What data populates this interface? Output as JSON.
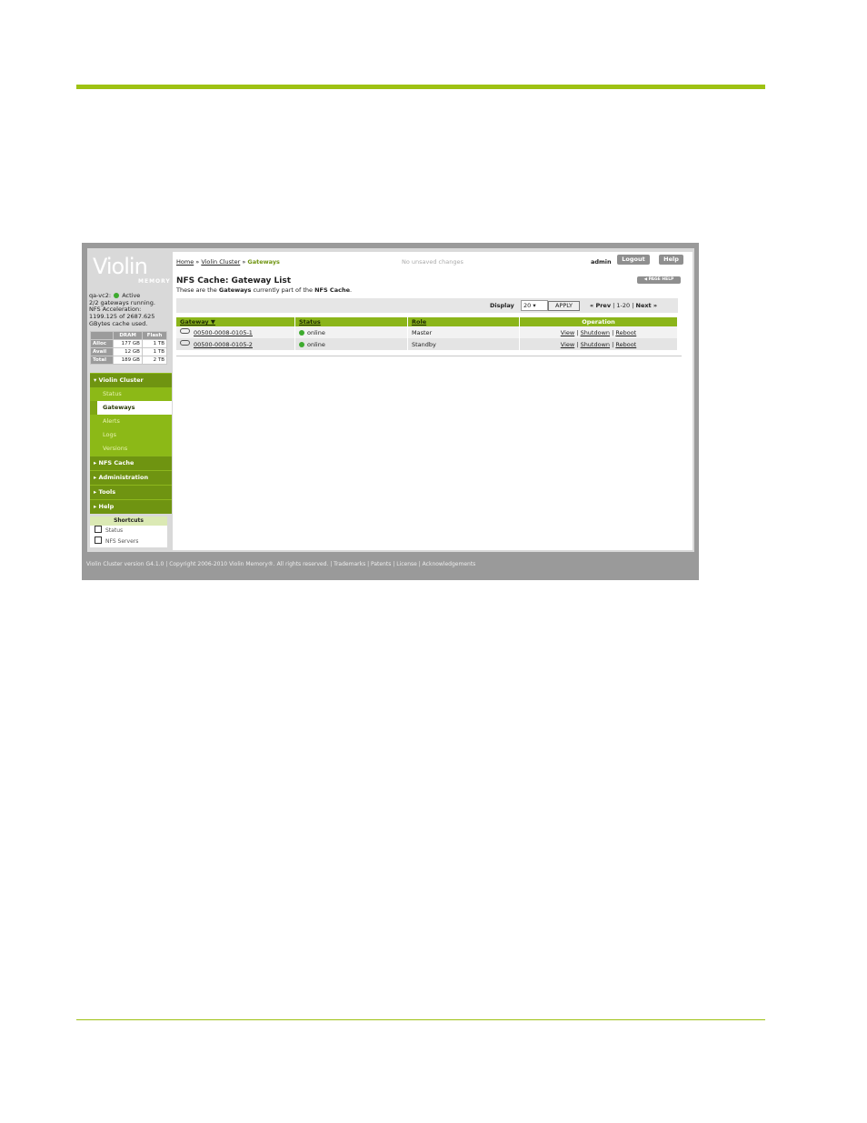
{
  "brand": {
    "logo_text": "Violin",
    "logo_sub": "MEMORY"
  },
  "system": {
    "name": "qa-vc2:",
    "state": "Active",
    "line1": "2/2 gateways running.",
    "line2": "NFS Acceleration:",
    "line3": "1199.125 of 2687.625",
    "line4": "GBytes cache used."
  },
  "stats": {
    "headers": [
      "DRAM",
      "Flash"
    ],
    "rows": [
      {
        "label": "Alloc",
        "dram": "177 GB",
        "flash": "1 TB"
      },
      {
        "label": "Avail",
        "dram": "12 GB",
        "flash": "1 TB"
      },
      {
        "label": "Total",
        "dram": "189 GB",
        "flash": "2 TB"
      }
    ]
  },
  "nav": {
    "violin_cluster": "Violin Cluster",
    "sub": [
      "Status",
      "Gateways",
      "Alerts",
      "Logs",
      "Versions"
    ],
    "nfs_cache": "NFS Cache",
    "administration": "Administration",
    "tools": "Tools",
    "help": "Help"
  },
  "shortcuts": {
    "title": "Shortcuts",
    "items": [
      "Status",
      "NFS Servers"
    ]
  },
  "header": {
    "crumb_home": "Home",
    "crumb_cluster": "Violin Cluster",
    "crumb_current": "Gateways",
    "unsaved": "No unsaved changes",
    "user": "admin",
    "logout": "Logout",
    "help": "Help",
    "page_help": "◀ PAGE HELP"
  },
  "page": {
    "title": "NFS Cache: Gateway List",
    "desc_a": "These are the ",
    "desc_b": "Gateways",
    "desc_c": " currently part of the ",
    "desc_d": "NFS Cache",
    "desc_e": "."
  },
  "toolbar": {
    "display_label": "Display",
    "display_value": "20 ▾",
    "apply": "APPLY",
    "prev": "« Prev",
    "range": "1-20",
    "next": "Next »"
  },
  "table": {
    "columns": [
      "Gateway ▼",
      "Status",
      "Role",
      "Operation"
    ],
    "rows": [
      {
        "gateway": "00500-0008-0105-1",
        "status": "online",
        "role": "Master"
      },
      {
        "gateway": "00500-0008-0105-2",
        "status": "online",
        "role": "Standby"
      }
    ],
    "ops": [
      "View",
      "Shutdown",
      "Reboot"
    ],
    "sep": "|"
  },
  "footer": {
    "text": "Violin Cluster version G4.1.0 | Copyright 2006-2010 Violin Memory®. All rights reserved. | Trademarks | Patents | License | Acknowledgements"
  },
  "colors": {
    "accent": "#9ec213",
    "nav": "#7ea613",
    "status_online": "#3daa2e"
  }
}
